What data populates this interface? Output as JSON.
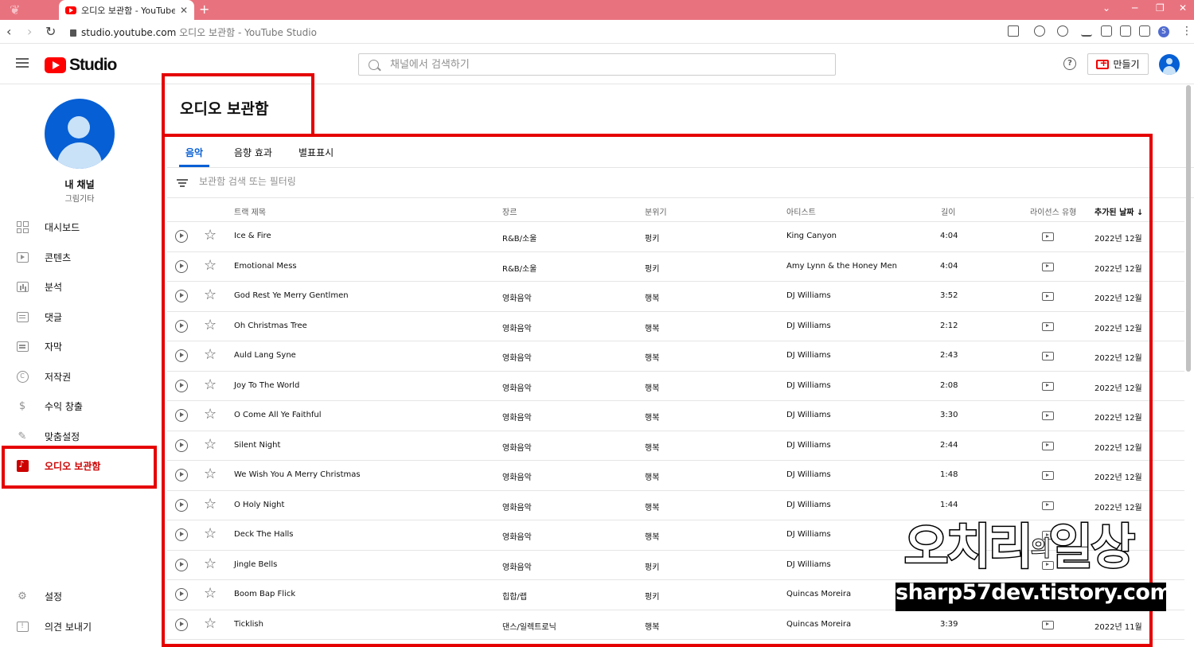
{
  "browser": {
    "tab_title": "오디오 보관함 - YouTube Studio",
    "tab_close": "✕",
    "new_tab": "+",
    "url_host": "studio.youtube.com",
    "url_rest": "오디오 보관함 - YouTube Studio",
    "profile_letter": "S"
  },
  "header": {
    "logo_text": "Studio",
    "search_placeholder": "채널에서 검색하기",
    "help_label": "?",
    "create_label": "만들기"
  },
  "sidebar": {
    "channel_name": "내 채널",
    "channel_sub": "그림기타",
    "items": [
      {
        "label": "대시보드",
        "icon": "dashboard-icon"
      },
      {
        "label": "콘텐츠",
        "icon": "content-icon"
      },
      {
        "label": "분석",
        "icon": "analytics-icon"
      },
      {
        "label": "댓글",
        "icon": "comments-icon"
      },
      {
        "label": "자막",
        "icon": "subtitles-icon"
      },
      {
        "label": "저작권",
        "icon": "copyright-icon"
      },
      {
        "label": "수익 창출",
        "icon": "monetization-icon"
      },
      {
        "label": "맞춤설정",
        "icon": "customization-icon"
      },
      {
        "label": "오디오 보관함",
        "icon": "audio-library-icon",
        "active": true
      }
    ],
    "bottom_items": [
      {
        "label": "설정",
        "icon": "settings-icon"
      },
      {
        "label": "의견 보내기",
        "icon": "feedback-icon"
      }
    ]
  },
  "main": {
    "title": "오디오 보관함",
    "tabs": [
      {
        "label": "음악",
        "active": true
      },
      {
        "label": "음향 효과"
      },
      {
        "label": "별표표시"
      }
    ],
    "filter_placeholder": "보관함 검색 또는 필터링",
    "columns": {
      "title": "트랙 제목",
      "genre": "장르",
      "mood": "분위기",
      "artist": "아티스트",
      "length": "길이",
      "license": "라이선스 유형",
      "date": "추가된 날짜",
      "sort_arrow": "↓"
    },
    "rows": [
      {
        "title": "Ice & Fire",
        "genre": "R&B/소울",
        "mood": "펑키",
        "artist": "King Canyon",
        "length": "4:04",
        "date": "2022년 12월"
      },
      {
        "title": "Emotional Mess",
        "genre": "R&B/소울",
        "mood": "펑키",
        "artist": "Amy Lynn & the Honey Men",
        "length": "4:04",
        "date": "2022년 12월"
      },
      {
        "title": "God Rest Ye Merry Gentlmen",
        "genre": "영화음악",
        "mood": "행복",
        "artist": "DJ Williams",
        "length": "3:52",
        "date": "2022년 12월"
      },
      {
        "title": "Oh Christmas Tree",
        "genre": "영화음악",
        "mood": "행복",
        "artist": "DJ Williams",
        "length": "2:12",
        "date": "2022년 12월"
      },
      {
        "title": "Auld Lang Syne",
        "genre": "영화음악",
        "mood": "행복",
        "artist": "DJ Williams",
        "length": "2:43",
        "date": "2022년 12월"
      },
      {
        "title": "Joy To The World",
        "genre": "영화음악",
        "mood": "행복",
        "artist": "DJ Williams",
        "length": "2:08",
        "date": "2022년 12월"
      },
      {
        "title": "O Come All Ye Faithful",
        "genre": "영화음악",
        "mood": "행복",
        "artist": "DJ Williams",
        "length": "3:30",
        "date": "2022년 12월"
      },
      {
        "title": "Silent Night",
        "genre": "영화음악",
        "mood": "행복",
        "artist": "DJ Williams",
        "length": "2:44",
        "date": "2022년 12월"
      },
      {
        "title": "We Wish You A Merry Christmas",
        "genre": "영화음악",
        "mood": "행복",
        "artist": "DJ Williams",
        "length": "1:48",
        "date": "2022년 12월"
      },
      {
        "title": "O Holy Night",
        "genre": "영화음악",
        "mood": "행복",
        "artist": "DJ Williams",
        "length": "1:44",
        "date": "2022년 12월"
      },
      {
        "title": "Deck The Halls",
        "genre": "영화음악",
        "mood": "행복",
        "artist": "DJ Williams",
        "length": "",
        "date": ""
      },
      {
        "title": "Jingle Bells",
        "genre": "영화음악",
        "mood": "펑키",
        "artist": "DJ Williams",
        "length": "",
        "date": ""
      },
      {
        "title": "Boom Bap Flick",
        "genre": "힙합/랩",
        "mood": "펑키",
        "artist": "Quincas Moreira",
        "length": "",
        "date": ""
      },
      {
        "title": "Ticklish",
        "genre": "댄스/일렉트로닉",
        "mood": "행복",
        "artist": "Quincas Moreira",
        "length": "3:39",
        "date": "2022년 11월"
      }
    ]
  },
  "watermark": {
    "big_a": "오치리",
    "big_small": "의",
    "big_b": "일상",
    "url": "sharp57dev.tistory.com"
  },
  "colors": {
    "accent_blue": "#065fd4",
    "brand_red": "#ff0000",
    "annotation_red": "#e50000",
    "tabbar_pink": "#e8737f"
  }
}
